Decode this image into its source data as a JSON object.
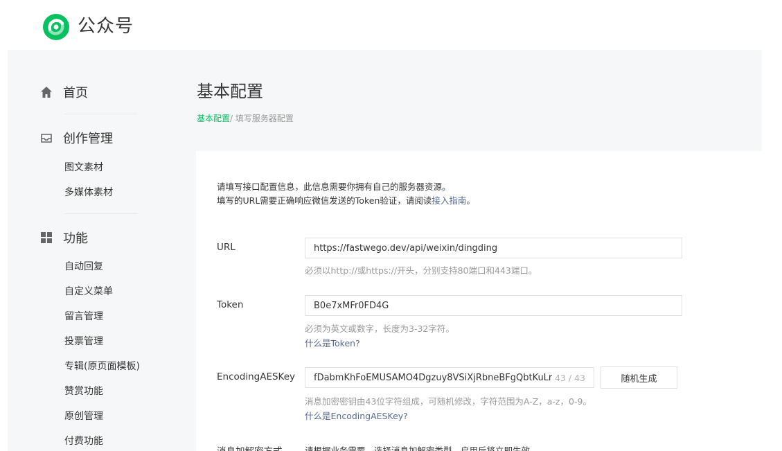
{
  "header": {
    "brand": "公众号"
  },
  "sidebar": {
    "home": "首页",
    "creation": {
      "title": "创作管理",
      "items": [
        "图文素材",
        "多媒体素材"
      ]
    },
    "features": {
      "title": "功能",
      "items": [
        "自动回复",
        "自定义菜单",
        "留言管理",
        "投票管理",
        "专辑(原页面模板)",
        "赞赏功能",
        "原创管理",
        "付费功能"
      ]
    }
  },
  "main": {
    "title": "基本配置",
    "breadcrumb": {
      "link": "基本配置",
      "separator": "/ ",
      "current": "填写服务器配置"
    },
    "intro": {
      "line1": "请填写接口配置信息，此信息需要你拥有自己的服务器资源。",
      "line2_prefix": "填写的URL需要正确响应微信发送的Token验证，请阅读",
      "line2_link": "接入指南",
      "line2_suffix": "。"
    },
    "url": {
      "label": "URL",
      "value": "https://fastwego.dev/api/weixin/dingding",
      "hint": "必须以http://或https://开头，分别支持80端口和443端口。"
    },
    "token": {
      "label": "Token",
      "value": "B0e7xMFr0FD4G",
      "hint": "必须为英文或数字，长度为3-32字符。",
      "link": "什么是Token?"
    },
    "aes": {
      "label": "EncodingAESKey",
      "value": "fDabmKhFoEMUSAMO4Dgzuy8VSiXjRbneBFgQbtKuLr",
      "counter": "43 / 43",
      "button": "随机生成",
      "hint": "消息加密密钥由43位字符组成，可随机修改，字符范围为A-Z，a-z，0-9。",
      "link": "什么是EncodingAESKey?"
    },
    "encrypt": {
      "label": "消息加解密方式",
      "hint": "请根据业务需要，选择消息加解密类型，启用后将立即生效"
    }
  },
  "colors": {
    "accent": "#07c160",
    "link": "#576b95",
    "muted": "#9a9a9a",
    "shell_bg": "#f6f7f8"
  }
}
